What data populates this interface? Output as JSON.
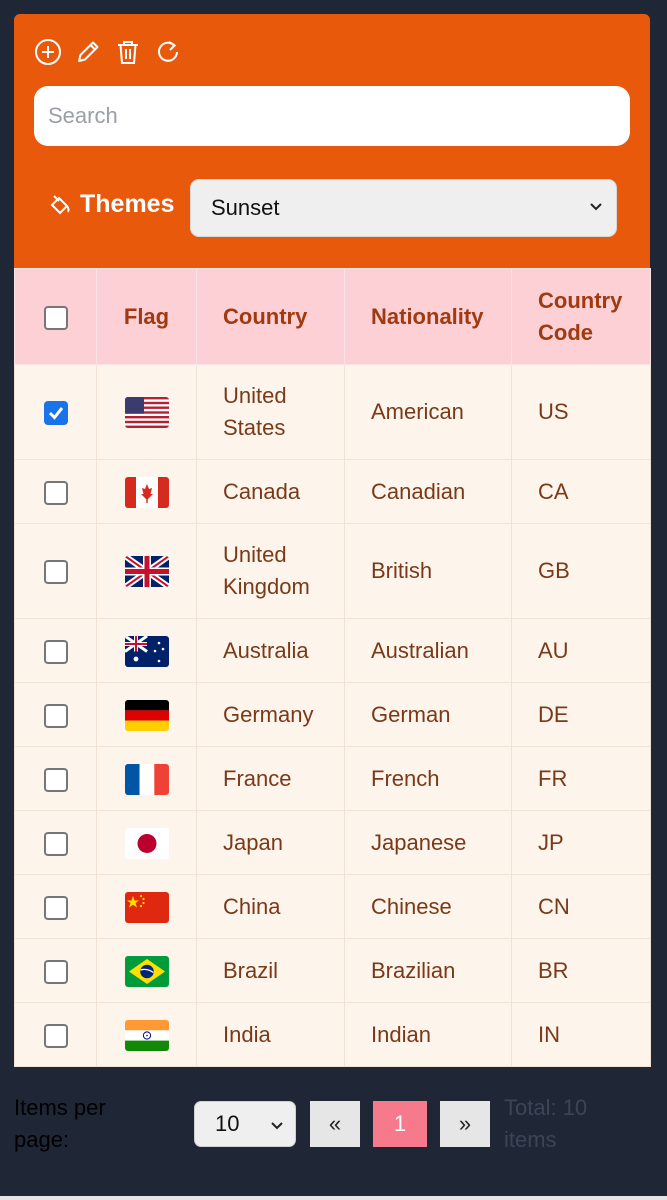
{
  "toolbar": {
    "icons": [
      "add-icon",
      "edit-icon",
      "delete-icon",
      "refresh-icon"
    ],
    "search_placeholder": "Search",
    "themes_label": "Themes",
    "theme_selected": "Sunset",
    "colors": {
      "toolbar_bg": "#e8590c",
      "header_bg": "#fcd0d5",
      "row_bg": "#fdf4eb",
      "page_bg": "#1f2636"
    }
  },
  "table": {
    "columns": [
      "",
      "Flag",
      "Country",
      "Nationality",
      "Country Code"
    ],
    "rows": [
      {
        "checked": true,
        "flag": "us-flag-icon",
        "country": "United States",
        "nationality": "American",
        "code": "US"
      },
      {
        "checked": false,
        "flag": "ca-flag-icon",
        "country": "Canada",
        "nationality": "Canadian",
        "code": "CA"
      },
      {
        "checked": false,
        "flag": "gb-flag-icon",
        "country": "United Kingdom",
        "nationality": "British",
        "code": "GB"
      },
      {
        "checked": false,
        "flag": "au-flag-icon",
        "country": "Australia",
        "nationality": "Australian",
        "code": "AU"
      },
      {
        "checked": false,
        "flag": "de-flag-icon",
        "country": "Germany",
        "nationality": "German",
        "code": "DE"
      },
      {
        "checked": false,
        "flag": "fr-flag-icon",
        "country": "France",
        "nationality": "French",
        "code": "FR"
      },
      {
        "checked": false,
        "flag": "jp-flag-icon",
        "country": "Japan",
        "nationality": "Japanese",
        "code": "JP"
      },
      {
        "checked": false,
        "flag": "cn-flag-icon",
        "country": "China",
        "nationality": "Chinese",
        "code": "CN"
      },
      {
        "checked": false,
        "flag": "br-flag-icon",
        "country": "Brazil",
        "nationality": "Brazilian",
        "code": "BR"
      },
      {
        "checked": false,
        "flag": "in-flag-icon",
        "country": "India",
        "nationality": "Indian",
        "code": "IN"
      }
    ]
  },
  "pagination": {
    "items_per_page_label": "Items per page:",
    "items_per_page_value": "10",
    "prev_label": "«",
    "current_page": "1",
    "next_label": "»",
    "total_text": "Total: 10 items"
  }
}
